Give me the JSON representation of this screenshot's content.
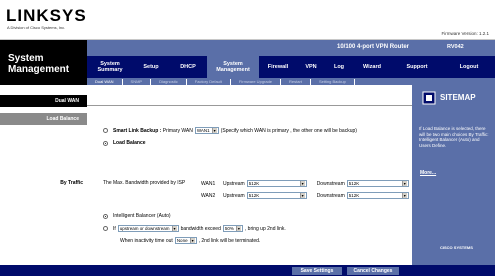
{
  "header": {
    "logo": "LINKSYS",
    "logo_sub": "A Division of Cisco Systems, Inc.",
    "firmware": "Firmware Version: 1.2.1",
    "title": "System Management",
    "router_name": "10/100 4-port VPN Router",
    "router_model": "RV042"
  },
  "tabs": [
    {
      "label": "System Summary",
      "active": false
    },
    {
      "label": "Setup",
      "active": false
    },
    {
      "label": "DHCP",
      "active": false
    },
    {
      "label": "System Management",
      "active": true
    },
    {
      "label": "Firewall",
      "active": false
    },
    {
      "label": "VPN",
      "active": false
    },
    {
      "label": "Log",
      "active": false
    },
    {
      "label": "Wizard",
      "active": false
    },
    {
      "label": "Support",
      "active": false
    },
    {
      "label": "Logout",
      "active": false
    }
  ],
  "subtabs": [
    "Dual WAN",
    "SNMP",
    "Diagnostic",
    "Factory Default",
    "Firmware Upgrade",
    "Restart",
    "Setting Backup"
  ],
  "left": {
    "dual_wan": "Dual WAN",
    "load_balance": "Load Balance",
    "by_traffic": "By Traffic"
  },
  "content": {
    "smart_link_label": "Smart Link Backup :",
    "primary_wan_label": "Primary WAN",
    "primary_wan_value": "WAN1",
    "smart_link_note": "(Specify which WAN is primary , the other one will be backup)",
    "load_balance_label": "Load Balance",
    "max_bandwidth_label": "The Max. Bandwidth provided by ISP",
    "wan1": "WAN1",
    "wan2": "WAN2",
    "upstream": "Upstream",
    "downstream": "Downstream",
    "wan1_up": "512K",
    "wan1_down": "512K",
    "wan2_up": "512K",
    "wan2_down": "512K",
    "intelligent_balancer": "Intelligent Balancer (Auto)",
    "if_label": "If",
    "traffic_dir": "upstream or downstream",
    "bandwidth_exceed": "bandwidth exceed",
    "percent": "50%",
    "bring_up": ", bring up 2nd link.",
    "inactivity_label": "When inactivity time out",
    "inactivity_value": "None",
    "terminated": ", 2nd link will be terminated."
  },
  "sidebar": {
    "sitemap": "SITEMAP",
    "help": "If Load Balance is selected, there will be two main choices By Traffic: Intelligent Balancer (Auto) and Users Define.",
    "more": "More...",
    "cisco": "CISCO SYSTEMS"
  },
  "footer": {
    "save": "Save Settings",
    "cancel": "Cancel Changes"
  },
  "colors": {
    "navy": "#000b6b",
    "accent": "#5a6fa8"
  }
}
